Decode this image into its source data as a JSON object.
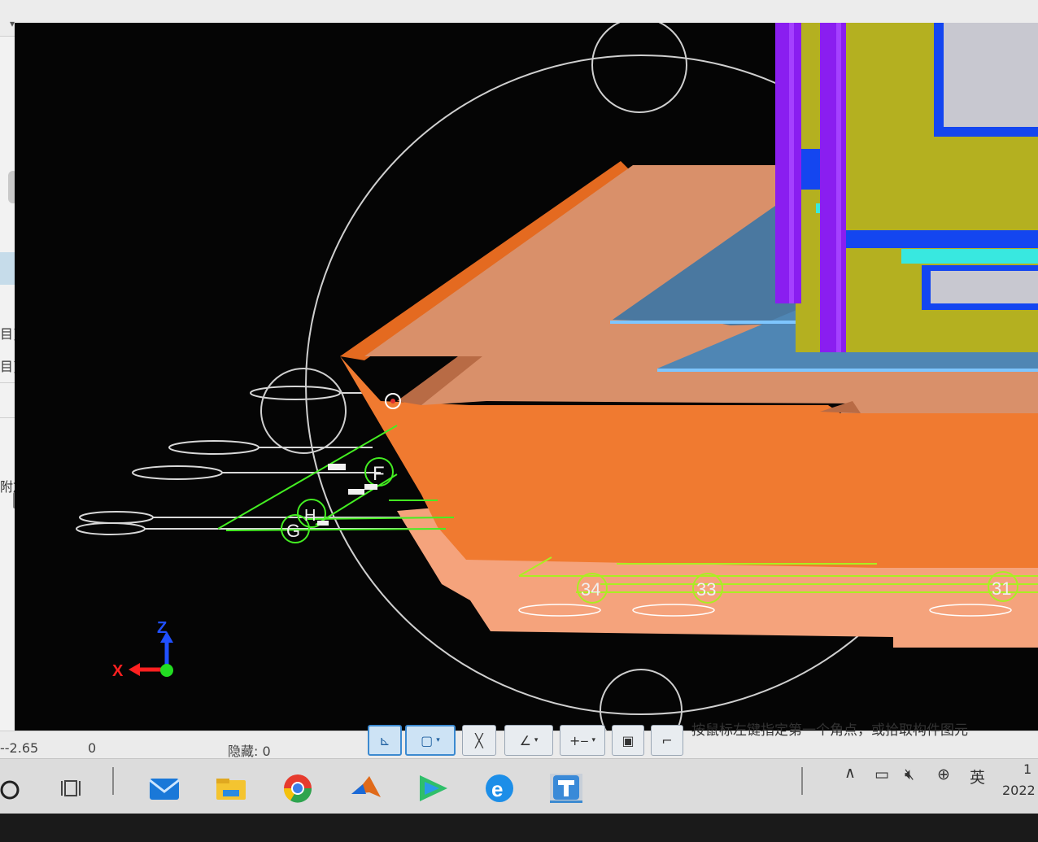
{
  "top_strip": {
    "dropdown_glyph": "▾"
  },
  "left_panel": {
    "labels": [
      "目)",
      "目)",
      "附加"
    ],
    "close_glyph": "✕",
    "expander_glyph": "▸",
    "checkbox_count": 8
  },
  "viewport": {
    "axis": {
      "z_label": "Z",
      "x_label": "X"
    },
    "grid_letters": [
      "F",
      "G",
      "H"
    ],
    "grid_numbers": [
      "34",
      "33",
      "31"
    ],
    "colors": {
      "background": "#050505",
      "slab_orange": "#f07a30",
      "slab_top": "#d9906a",
      "slab_light": "#f5a37c",
      "wall_olive": "#b4b020",
      "purple": "#8a1ef0",
      "blue": "#1446f0",
      "cyan": "#38e8e0",
      "grid_green": "#44ee22"
    }
  },
  "status_bar": {
    "coord_value": "--2.65",
    "second_value": "0",
    "hidden_label": "隐藏: 0",
    "hint": "按鼠标左键指定第一个角点，或拾取构件图元"
  },
  "toolbar": {
    "buttons": [
      {
        "name": "ortho-snap-button",
        "glyph": "⊾",
        "active": true,
        "caret": false
      },
      {
        "name": "rect-select-button",
        "glyph": "▢",
        "active": true,
        "caret": true
      },
      {
        "name": "cross-select-button",
        "glyph": "╳",
        "active": false,
        "caret": false
      },
      {
        "name": "angle-button",
        "glyph": "∠",
        "active": false,
        "caret": true
      },
      {
        "name": "dimension-button",
        "glyph": "+‒",
        "active": false,
        "caret": true
      },
      {
        "name": "view-button",
        "glyph": "▣",
        "active": false,
        "caret": false
      },
      {
        "name": "arc-button",
        "glyph": "⌐",
        "active": false,
        "caret": false
      }
    ],
    "caret_glyph": "▾"
  },
  "taskbar": {
    "ime_label": "英",
    "clock_line1": "1",
    "clock_line2": "2022",
    "tray_icons": [
      "chevron-up-icon",
      "battery-icon",
      "volume-muted-icon",
      "globe-icon"
    ]
  }
}
